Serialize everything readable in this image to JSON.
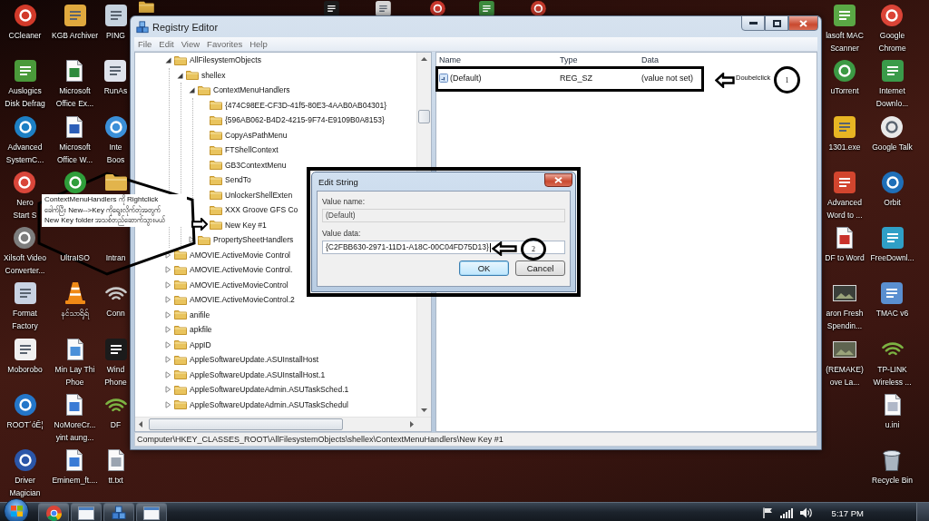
{
  "desktop": {
    "top_icons": [
      {
        "kind": "folder",
        "color": "#d9a93e"
      },
      {
        "kind": "tile",
        "color": "#1c1c1c"
      },
      {
        "kind": "tile",
        "color": "#d6d6d6"
      },
      {
        "kind": "disc",
        "color": "#c8372d"
      },
      {
        "kind": "tile",
        "color": "#3d8b3d"
      },
      {
        "kind": "disc",
        "color": "#c0392b"
      }
    ],
    "left_columns": [
      {
        "icons": [
          {
            "kind": "disc",
            "color": "#d23a2a",
            "label": "CCleaner"
          },
          {
            "kind": "tile",
            "color": "#4a9a3a",
            "label": "Auslogics\nDisk Defrag"
          },
          {
            "kind": "disc",
            "color": "#1d7fc4",
            "label": "Advanced\nSystemC..."
          },
          {
            "kind": "disc",
            "color": "#d9463a",
            "label": "Nero\nStart S"
          },
          {
            "kind": "disc",
            "color": "#7d7d7d",
            "label": "Xilsoft Video\nConverter..."
          },
          {
            "kind": "tile",
            "color": "#c9d3e3",
            "label": "Format\nFactory"
          },
          {
            "kind": "tile",
            "color": "#f0f0f0",
            "label": "Moborobo"
          },
          {
            "kind": "disc",
            "color": "#2476c9",
            "label": "ROOT´óÊ¦"
          },
          {
            "kind": "disc",
            "color": "#2b56a8",
            "label": "Driver\nMagician"
          }
        ]
      },
      {
        "icons": [
          {
            "kind": "tile",
            "color": "#e0a93e",
            "label": "KGB Archiver"
          },
          {
            "kind": "document",
            "color": "#2e8b3d",
            "label": "Microsoft\nOffice Ex..."
          },
          {
            "kind": "document",
            "color": "#2b5eb8",
            "label": "Microsoft\nOffice W..."
          },
          {
            "kind": "disc",
            "color": "#2f9e3a"
          },
          {
            "label": "UltraISO"
          },
          {
            "kind": "cone",
            "color": "#f08a16",
            "label": "နင်သာရိုရ်"
          },
          {
            "kind": "document",
            "color": "#4a90d9",
            "label": "Min Lay Thi\nPhoe"
          },
          {
            "kind": "document",
            "color": "#3a7bd5",
            "label": "NoMoreCr...\nyint aung..."
          },
          {
            "kind": "document",
            "color": "#3a7bd5",
            "label": "Eminem_ft...."
          }
        ]
      },
      {
        "icons": [
          {
            "kind": "tile",
            "color": "#c6d2de",
            "label": "PING"
          },
          {
            "kind": "tile",
            "color": "#dfe3ec",
            "label": "RunAs"
          },
          {
            "kind": "disc",
            "color": "#3b8fd8",
            "label": "Inte\nBoos"
          },
          {
            "kind": "folder",
            "color": "#e2b44c"
          },
          {
            "label": "Intran"
          },
          {
            "kind": "wifi",
            "color": "#c8c8c8",
            "label": "Conn"
          },
          {
            "kind": "tile",
            "color": "#1b1b1b",
            "label": "Wind\nPhone"
          },
          {
            "kind": "wifi",
            "color": "#7cb342",
            "label": "DF"
          },
          {
            "kind": "document",
            "color": "#9aa4b0",
            "label": "tt.txt"
          }
        ]
      }
    ],
    "right_columns": [
      {
        "icons": [
          {
            "kind": "tile",
            "color": "#5aa845",
            "label": "lasoft MAC\nScanner"
          },
          {
            "kind": "disc",
            "color": "#3c9a44",
            "label": "uTorrent"
          },
          {
            "kind": "tile",
            "color": "#e8b523",
            "label": "1301.exe"
          },
          {
            "kind": "tile",
            "color": "#d2452e",
            "label": "Advanced\nWord to ..."
          },
          {
            "kind": "document",
            "color": "#c8302a",
            "label": "DF to Word"
          },
          {
            "kind": "thumbnail",
            "color": "#3b3f3a",
            "label": "aron Fresh\nSpendin..."
          },
          {
            "kind": "thumbnail",
            "color": "#5f6450",
            "label": "(REMAKE)\nove La..."
          }
        ]
      },
      {
        "icons": [
          {
            "kind": "disc",
            "color": "#db4437",
            "label": "Google\nChrome"
          },
          {
            "kind": "tile",
            "color": "#3a9b4a",
            "label": "Internet\nDownlo..."
          },
          {
            "kind": "disc",
            "color": "#e9e9e9",
            "label": "Google Talk"
          },
          {
            "kind": "disc",
            "color": "#1f6fb8",
            "label": "Orbit"
          },
          {
            "kind": "tile",
            "color": "#2f9fc6",
            "label": "FreeDownl..."
          },
          {
            "kind": "tile",
            "color": "#5a8fd0",
            "label": "TMAC v6"
          },
          {
            "kind": "wifi",
            "color": "#7cb342",
            "label": "TP-LINK\nWireless ..."
          },
          {
            "kind": "document",
            "color": "#b0b8c8",
            "label": "u.ini"
          },
          {
            "kind": "bin",
            "color": "#a9b4c0",
            "label": "Recycle Bin"
          }
        ]
      }
    ]
  },
  "registry_editor": {
    "title": "Registry Editor",
    "menu": [
      "File",
      "Edit",
      "View",
      "Favorites",
      "Help"
    ],
    "tree": [
      {
        "label": "AllFilesystemObjects",
        "expanded": true,
        "children": [
          {
            "label": "shellex",
            "expanded": true,
            "children": [
              {
                "label": "ContextMenuHandlers",
                "expanded": true,
                "children": [
                  {
                    "label": "{474C98EE-CF3D-41f5-80E3-4AAB0AB04301}"
                  },
                  {
                    "label": "{596AB062-B4D2-4215-9F74-E9109B0A8153}"
                  },
                  {
                    "label": "CopyAsPathMenu"
                  },
                  {
                    "label": "FTShellContext"
                  },
                  {
                    "label": "GB3ContextMenu"
                  },
                  {
                    "label": "SendTo"
                  },
                  {
                    "label": "UnlockerShellExten"
                  },
                  {
                    "label": "XXX Groove GFS Co"
                  },
                  {
                    "label": "New Key #1"
                  }
                ]
              },
              {
                "label": "PropertySheetHandlers",
                "expanded": false
              }
            ]
          }
        ]
      },
      {
        "label": "AMOVIE.ActiveMovie Control",
        "expanded": false
      },
      {
        "label": "AMOVIE.ActiveMovie Control.",
        "expanded": false
      },
      {
        "label": "AMOVIE.ActiveMovieControl",
        "expanded": false
      },
      {
        "label": "AMOVIE.ActiveMovieControl.2",
        "expanded": false
      },
      {
        "label": "anifile",
        "expanded": false
      },
      {
        "label": "apkfile",
        "expanded": false
      },
      {
        "label": "AppID",
        "expanded": false
      },
      {
        "label": "AppleSoftwareUpdate.ASUInstallHost",
        "expanded": false
      },
      {
        "label": "AppleSoftwareUpdate.ASUInstallHost.1",
        "expanded": false
      },
      {
        "label": "AppleSoftwareUpdateAdmin.ASUTaskSched.1",
        "expanded": false
      },
      {
        "label": "AppleSoftwareUpdateAdmin.ASUTaskSchedul",
        "expanded": false
      }
    ],
    "values": {
      "columns": [
        "Name",
        "Type",
        "Data"
      ],
      "rows": [
        {
          "name": "(Default)",
          "type": "REG_SZ",
          "data": "(value not set)"
        }
      ]
    },
    "status_bar": "Computer\\HKEY_CLASSES_ROOT\\AllFilesystemObjects\\shellex\\ContextMenuHandlers\\New Key #1"
  },
  "edit_string_dialog": {
    "title": "Edit String",
    "fields": [
      {
        "label": "Value name:",
        "value": "(Default)",
        "read_only": true,
        "focused": false
      },
      {
        "label": "Value data:",
        "value": "{C2FBB630-2971-11D1-A18C-00C04FD75D13}",
        "read_only": false,
        "focused": true
      }
    ],
    "buttons": [
      {
        "label": "OK",
        "default": true
      },
      {
        "label": "Cancel",
        "default": false
      }
    ]
  },
  "annotations": {
    "callout_note": "ContextMenuHandlers ကို Rightclick\nခေါက်ပြီး New-->Key ကိုရွေးလိုက်တဲ့အတွက်\nNew Key folder အသစ်တည်ဆောက်သွားမယ်",
    "steps": [
      {
        "number": "1",
        "text": "Doubelclick"
      },
      {
        "number": "2"
      }
    ]
  },
  "taskbar": {
    "buttons": [
      {
        "kind": "round-logo"
      },
      {
        "kind": "window"
      },
      {
        "kind": "cubes"
      },
      {
        "kind": "window"
      }
    ],
    "clock": "5:17 PM"
  }
}
